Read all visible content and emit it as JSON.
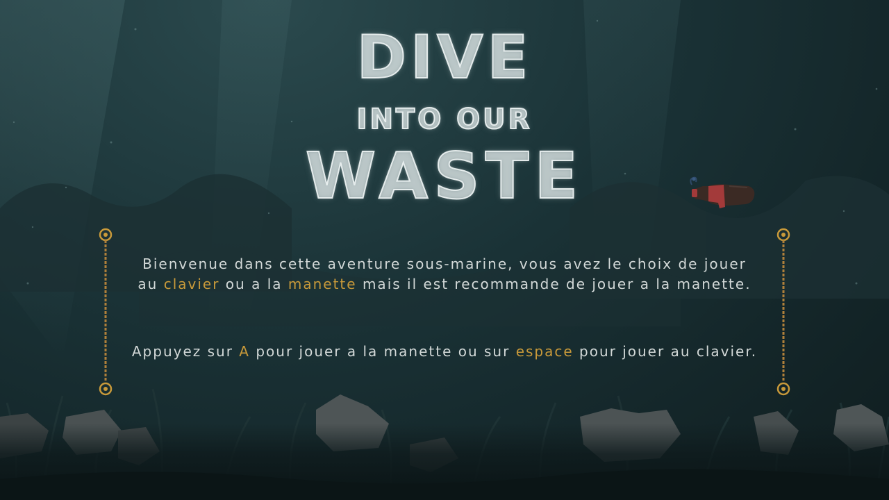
{
  "title": {
    "line1": "DIVE",
    "line2": "INTO OUR",
    "line3": "WASTE"
  },
  "intro": {
    "part1": "Bienvenue dans cette aventure sous-marine, vous avez le choix de jouer",
    "part2": "au ",
    "keyboard": "clavier",
    "part3": " ou a la ",
    "gamepad": "manette",
    "part4": " mais il est recommande de jouer a la manette."
  },
  "instructions": {
    "part1": "Appuyez sur ",
    "button_a": "A",
    "part2": " pour jouer a la manette ou sur ",
    "space_key": "espace",
    "part3": " pour jouer au clavier."
  },
  "colors": {
    "highlight": "#c99a3a",
    "text": "#d3d9d8",
    "title": "#dfe7e6",
    "water": "#1a3236"
  },
  "icons": {
    "rope_left": "rope-divider-icon",
    "rope_right": "rope-divider-icon",
    "bottle": "plastic-bottle-icon"
  }
}
